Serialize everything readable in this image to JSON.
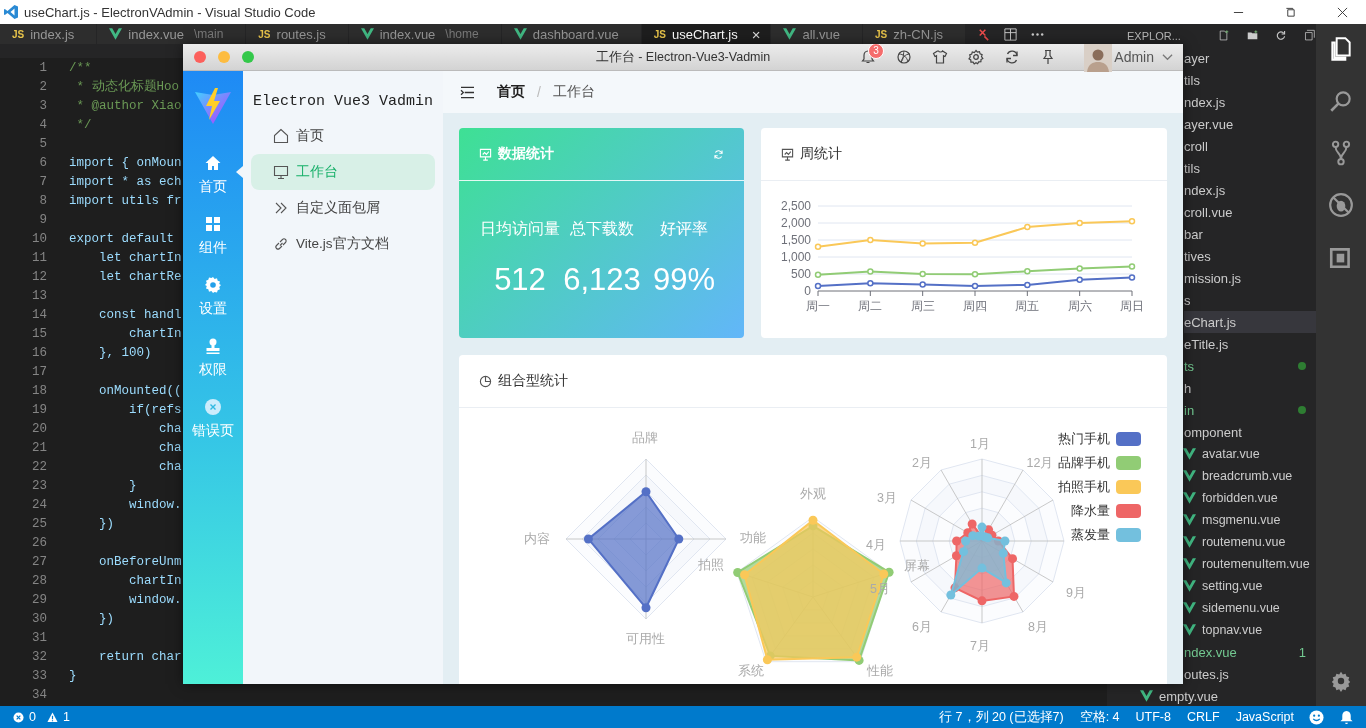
{
  "vscode": {
    "title": "useChart.js - ElectronVAdmin - Visual Studio Code",
    "tabs": [
      {
        "kind": "js",
        "icon_text": "JS",
        "label": "index.js",
        "selected": false
      },
      {
        "kind": "vue",
        "label": "index.vue",
        "path": "\\main",
        "selected": false
      },
      {
        "kind": "js",
        "icon_text": "JS",
        "label": "routes.js",
        "selected": false
      },
      {
        "kind": "vue",
        "label": "index.vue",
        "path": "\\home",
        "selected": false
      },
      {
        "kind": "vue",
        "label": "dashboard.vue",
        "selected": false
      },
      {
        "kind": "js",
        "icon_text": "JS",
        "label": "useChart.js",
        "close": "×",
        "selected": true
      },
      {
        "kind": "vue",
        "label": "all.vue",
        "selected": false
      },
      {
        "kind": "js",
        "icon_text": "JS",
        "label": "zh-CN.js",
        "selected": false
      }
    ],
    "explorer_title": "EXPLOR...",
    "code_lines": [
      {
        "number": "1",
        "kind": "comment",
        "text": "/**"
      },
      {
        "number": "2",
        "kind": "comment",
        "text": " * 动态化标题Hoo"
      },
      {
        "number": "3",
        "kind": "comment",
        "text": " * @author Xiao"
      },
      {
        "number": "4",
        "kind": "comment",
        "text": " */"
      },
      {
        "number": "5",
        "kind": "blank"
      },
      {
        "number": "6",
        "kind": "code",
        "text": "import { onMoun"
      },
      {
        "number": "7",
        "kind": "code",
        "text": "import * as ech"
      },
      {
        "number": "8",
        "kind": "code",
        "text": "import utils fr"
      },
      {
        "number": "9",
        "kind": "blank"
      },
      {
        "number": "10",
        "kind": "code",
        "text": "export default "
      },
      {
        "number": "11",
        "kind": "code",
        "text": "    let chartIn"
      },
      {
        "number": "12",
        "kind": "code",
        "text": "    let chartRe"
      },
      {
        "number": "13",
        "kind": "blank"
      },
      {
        "number": "14",
        "kind": "code",
        "text": "    const handl"
      },
      {
        "number": "15",
        "kind": "code",
        "text": "        chartIn"
      },
      {
        "number": "16",
        "kind": "code",
        "text": "    }, 100)"
      },
      {
        "number": "17",
        "kind": "blank"
      },
      {
        "number": "18",
        "kind": "code",
        "text": "    onMounted(("
      },
      {
        "number": "19",
        "kind": "code",
        "text": "        if(refs"
      },
      {
        "number": "20",
        "kind": "code",
        "text": "            cha"
      },
      {
        "number": "21",
        "kind": "code",
        "text": "            cha"
      },
      {
        "number": "22",
        "kind": "code",
        "text": "            cha"
      },
      {
        "number": "23",
        "kind": "code",
        "text": "        }"
      },
      {
        "number": "24",
        "kind": "code",
        "text": "        window."
      },
      {
        "number": "25",
        "kind": "code",
        "text": "    })"
      },
      {
        "number": "26",
        "kind": "blank"
      },
      {
        "number": "27",
        "kind": "code",
        "text": "    onBeforeUnm"
      },
      {
        "number": "28",
        "kind": "code",
        "text": "        chartIn"
      },
      {
        "number": "29",
        "kind": "code",
        "text": "        window."
      },
      {
        "number": "30",
        "kind": "code",
        "text": "    })"
      },
      {
        "number": "31",
        "kind": "blank"
      },
      {
        "number": "32",
        "kind": "code",
        "text": "    return char"
      },
      {
        "number": "33",
        "kind": "code",
        "text": "}"
      },
      {
        "number": "34",
        "kind": "blank"
      }
    ],
    "explorer_items": [
      {
        "kind": "cut",
        "label": "ayer",
        "selected": false,
        "modified": false
      },
      {
        "kind": "cut",
        "label": "tils",
        "selected": false,
        "modified": false
      },
      {
        "kind": "cut",
        "label": "ndex.js",
        "selected": false,
        "modified": false
      },
      {
        "kind": "cut",
        "label": "ayer.vue",
        "selected": false,
        "modified": false
      },
      {
        "kind": "cut",
        "label": "croll",
        "selected": false,
        "modified": false
      },
      {
        "kind": "cut",
        "label": "tils",
        "selected": false,
        "modified": false
      },
      {
        "kind": "cut",
        "label": "ndex.js",
        "selected": false,
        "modified": false
      },
      {
        "kind": "cut",
        "label": "croll.vue",
        "selected": false,
        "modified": false
      },
      {
        "kind": "cut",
        "label": "bar",
        "selected": false,
        "modified": false
      },
      {
        "kind": "cut",
        "label": "tives",
        "selected": false,
        "modified": false
      },
      {
        "kind": "cut",
        "label": "mission.js",
        "selected": false,
        "modified": false
      },
      {
        "kind": "cut",
        "label": "s",
        "selected": false,
        "modified": false
      },
      {
        "kind": "cut",
        "label": "eChart.js",
        "selected": true,
        "modified": false
      },
      {
        "kind": "cut",
        "label": "eTitle.js",
        "selected": false,
        "modified": false
      },
      {
        "kind": "cut",
        "label": "ts",
        "selected": false,
        "modified": true
      },
      {
        "kind": "cut",
        "label": "h",
        "selected": false,
        "modified": false
      },
      {
        "kind": "cut",
        "label": "in",
        "selected": false,
        "modified": true
      },
      {
        "kind": "cut",
        "label": "omponent",
        "selected": false,
        "modified": false
      },
      {
        "kind": "vue",
        "label": "avatar.vue",
        "selected": false,
        "modified": false
      },
      {
        "kind": "vue",
        "label": "breadcrumb.vue",
        "selected": false,
        "modified": false
      },
      {
        "kind": "vue",
        "label": "forbidden.vue",
        "selected": false,
        "modified": false
      },
      {
        "kind": "vue",
        "label": "msgmenu.vue",
        "selected": false,
        "modified": false
      },
      {
        "kind": "vue",
        "label": "routemenu.vue",
        "selected": false,
        "modified": false
      },
      {
        "kind": "vue",
        "label": "routemenuItem.vue",
        "selected": false,
        "modified": false
      },
      {
        "kind": "vue",
        "label": "setting.vue",
        "selected": false,
        "modified": false
      },
      {
        "kind": "vue",
        "label": "sidemenu.vue",
        "selected": false,
        "modified": false
      },
      {
        "kind": "vue",
        "label": "topnav.vue",
        "selected": false,
        "modified": false
      },
      {
        "kind": "cut",
        "label": "ndex.vue",
        "badge": "1",
        "selected": false,
        "modified": true
      },
      {
        "kind": "cut",
        "label": "outes.js",
        "selected": false,
        "modified": false
      },
      {
        "kind": "vue-top",
        "label": "empty.vue",
        "selected": false,
        "modified": false
      }
    ],
    "status_bar": {
      "errors": "0",
      "warnings": "1",
      "items": [
        "行 7，列 20 (已选择7)",
        "空格: 4",
        "UTF-8",
        "CRLF",
        "JavaScript"
      ]
    }
  },
  "app": {
    "title": "工作台 - Electron-Vue3-Vadmin",
    "notification_count": "3",
    "user": "Admin",
    "nav": [
      {
        "kind": "home",
        "label": "首页",
        "selected": true
      },
      {
        "kind": "grid",
        "label": "组件",
        "selected": false
      },
      {
        "kind": "gear",
        "label": "设置",
        "selected": false
      },
      {
        "kind": "stamp",
        "label": "权限",
        "selected": false
      },
      {
        "kind": "error",
        "label": "错误页",
        "selected": false
      }
    ],
    "brand": "Electron Vue3 Vadmin",
    "menu": [
      {
        "kind": "home",
        "label": "首页",
        "selected": false
      },
      {
        "kind": "monitor",
        "label": "工作台",
        "selected": true
      },
      {
        "kind": "chevrons",
        "label": "自定义面包屑",
        "selected": false
      },
      {
        "kind": "link",
        "label": "Vite.js官方文档",
        "selected": false
      }
    ],
    "breadcrumb": {
      "items": [
        "首页",
        "工作台"
      ],
      "separator": "/"
    },
    "stats_card": {
      "title": "数据统计",
      "stats": [
        {
          "label": "日均访问量",
          "value": "512"
        },
        {
          "label": "总下载数",
          "value": "6,123"
        },
        {
          "label": "好评率",
          "value": "99%"
        }
      ]
    },
    "weekly_card": {
      "title": "周统计",
      "chart_data": {
        "type": "line",
        "grid": true,
        "categories": [
          "周一",
          "周二",
          "周三",
          "周四",
          "周五",
          "周六",
          "周日"
        ],
        "ylim": [
          0,
          2500
        ],
        "yticks": [
          {
            "value": 0,
            "label": "0"
          },
          {
            "value": 500,
            "label": "500"
          },
          {
            "value": 1000,
            "label": "1,000"
          },
          {
            "value": 1500,
            "label": "1,500"
          },
          {
            "value": 2000,
            "label": "2,000"
          },
          {
            "value": 2500,
            "label": "2,500"
          }
        ],
        "series": [
          {
            "color": "#fac858",
            "marker": true,
            "values": [
              1300,
              1500,
              1400,
              1420,
              1880,
              2000,
              2050
            ]
          },
          {
            "color": "#91cc75",
            "marker": true,
            "values": [
              480,
              570,
              500,
              490,
              580,
              660,
              720
            ]
          },
          {
            "color": "#5470c6",
            "marker": true,
            "values": [
              150,
              230,
              190,
              150,
              180,
              330,
              400
            ]
          }
        ]
      }
    },
    "combo_card": {
      "title": "组合型统计",
      "radars": [
        {
          "kind": "diamond",
          "axes": [
            "品牌",
            "内容",
            "拍照",
            "可用性"
          ]
        },
        {
          "kind": "pentagon",
          "axes": [
            "外观",
            "功能",
            "屏幕",
            "系统",
            "性能"
          ]
        },
        {
          "kind": "months",
          "axes": [
            "1月",
            "2月",
            "12月",
            "3月",
            "4月",
            "5月",
            "9月",
            "6月",
            "8月",
            "7月"
          ]
        }
      ],
      "legend": [
        {
          "label": "热门手机",
          "color": "#5470c6"
        },
        {
          "label": "品牌手机",
          "color": "#91cc75"
        },
        {
          "label": "拍照手机",
          "color": "#fac858"
        },
        {
          "label": "降水量",
          "color": "#ee6666"
        },
        {
          "label": "蒸发量",
          "color": "#73c0de"
        }
      ]
    }
  }
}
